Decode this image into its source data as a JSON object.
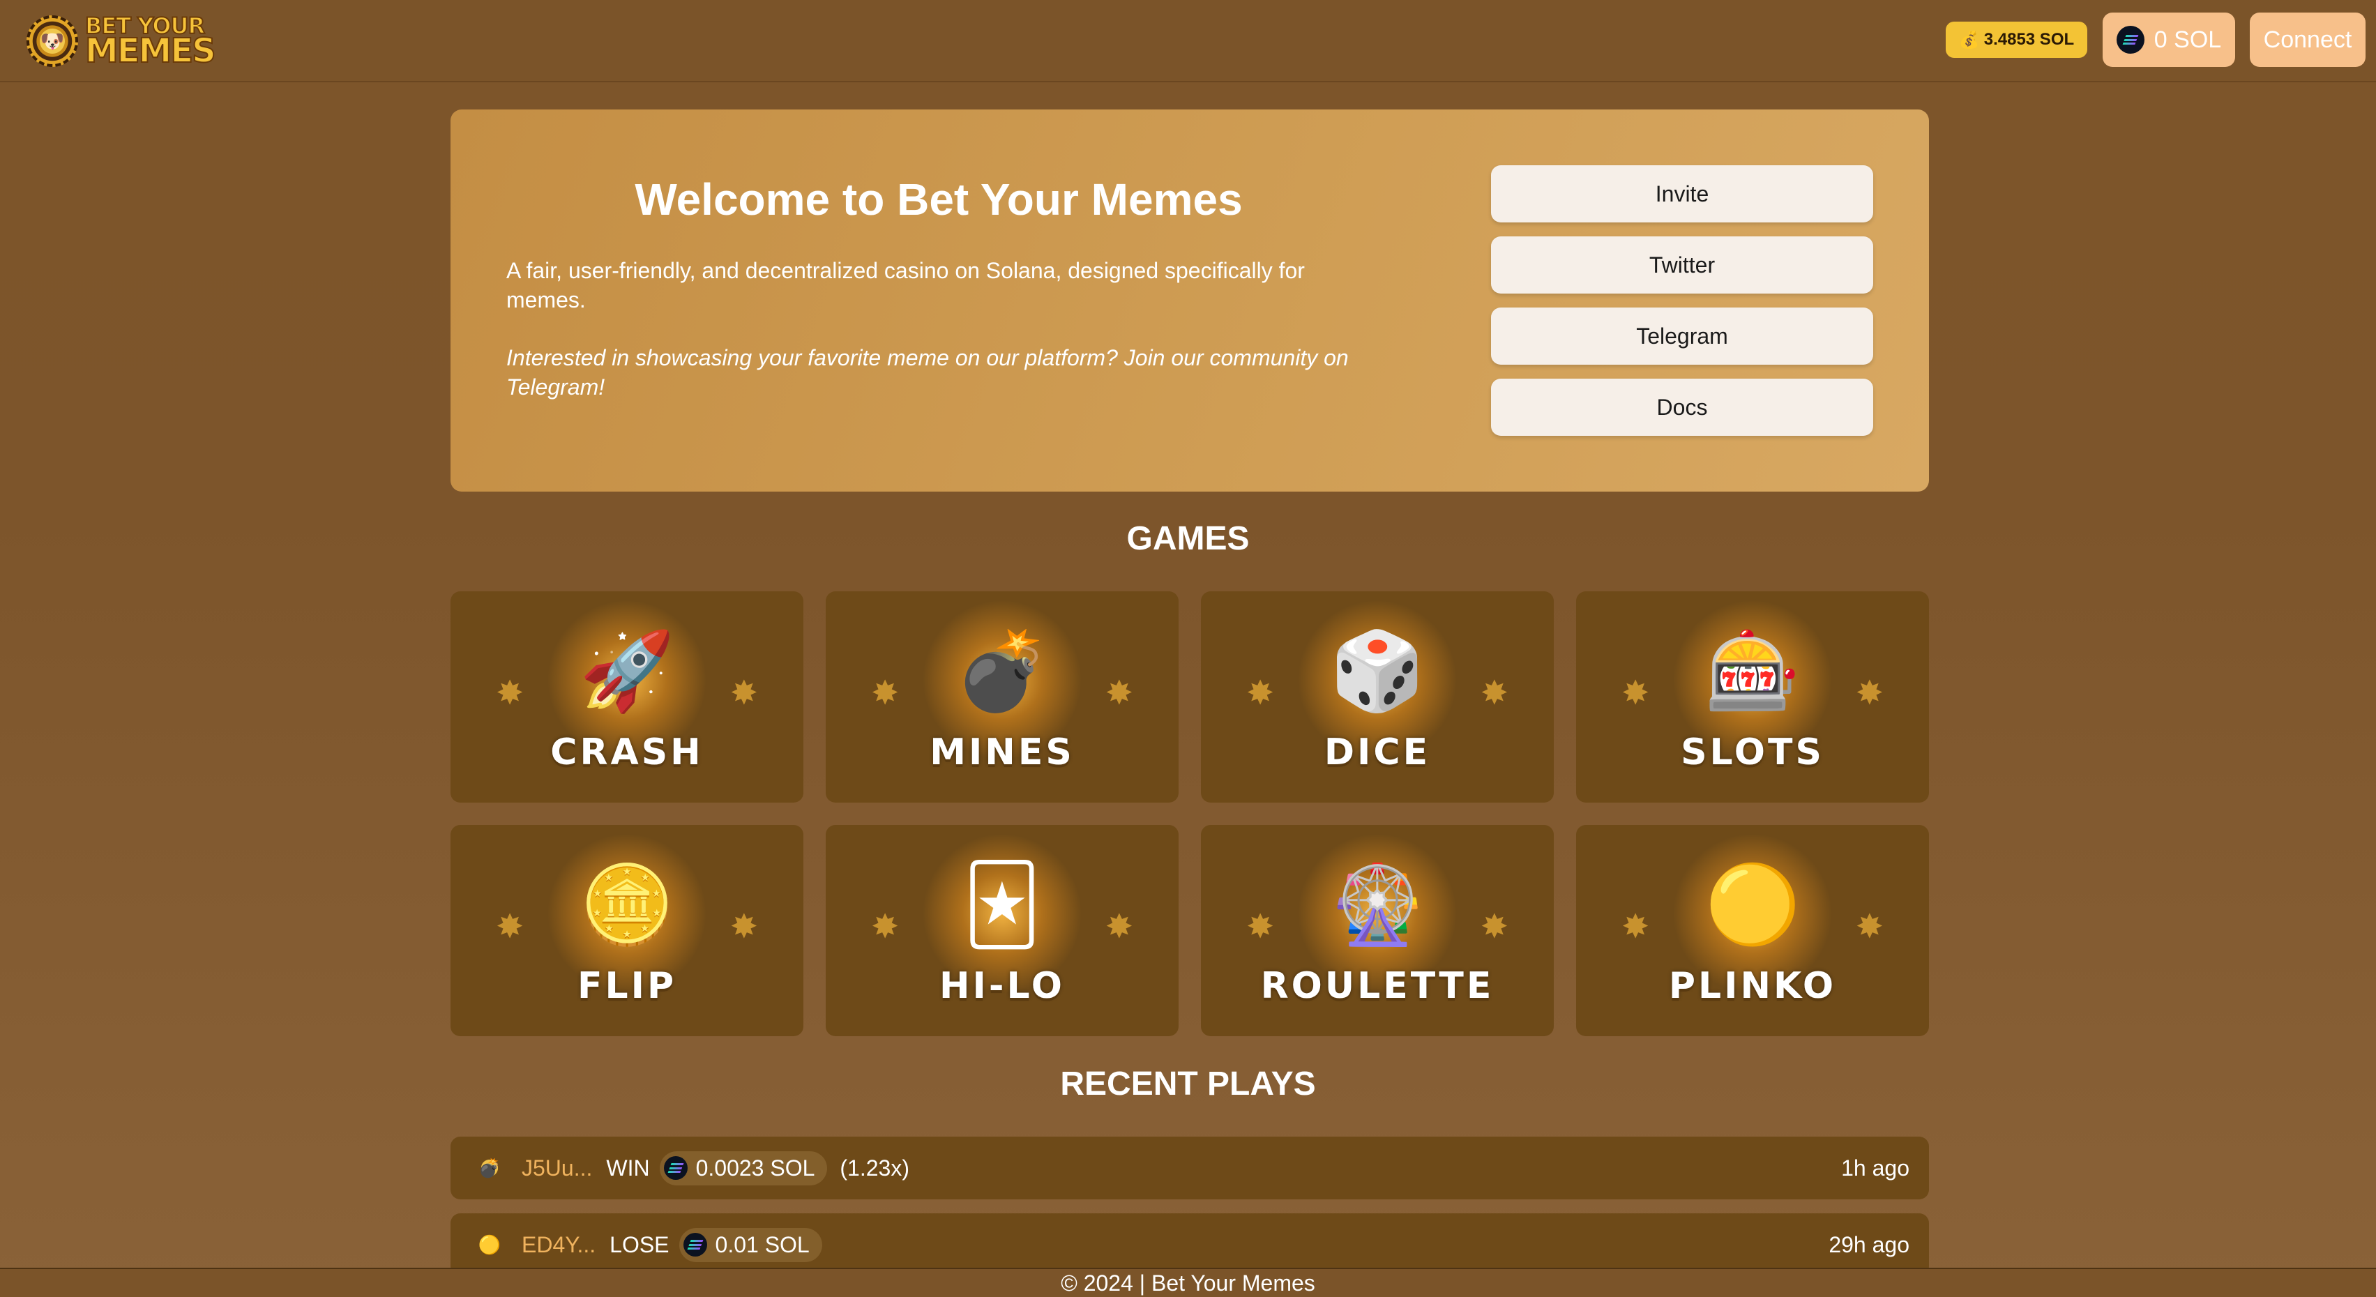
{
  "header": {
    "logo": {
      "line1": "BET YOUR",
      "line2": "MEMES",
      "icon": "casino-chip-logo-icon"
    },
    "balance": "3.4853 SOL",
    "wallet_balance": "0 SOL",
    "connect_label": "Connect"
  },
  "hero": {
    "title": "Welcome to Bet Your Memes",
    "description": "A fair, user-friendly, and decentralized casino on Solana, designed specifically for memes.",
    "cta": "Interested in showcasing your favorite meme on our platform? Join our community on Telegram!",
    "links": [
      "Invite",
      "Twitter",
      "Telegram",
      "Docs"
    ]
  },
  "games_title": "GAMES",
  "games": [
    {
      "name": "CRASH",
      "icon": "rocket-icon"
    },
    {
      "name": "MINES",
      "icon": "bomb-icon"
    },
    {
      "name": "DICE",
      "icon": "dice-icon"
    },
    {
      "name": "SLOTS",
      "icon": "slot-machine-icon"
    },
    {
      "name": "FLIP",
      "icon": "coin-flip-icon"
    },
    {
      "name": "HI-LO",
      "icon": "playing-cards-icon"
    },
    {
      "name": "ROULETTE",
      "icon": "roulette-wheel-icon"
    },
    {
      "name": "PLINKO",
      "icon": "plinko-coin-icon"
    }
  ],
  "recent_title": "RECENT PLAYS",
  "recent_plays": [
    {
      "player": "J5Uu...",
      "outcome": "WIN",
      "amount": "0.0023 SOL",
      "multiplier": "(1.23x)",
      "time": "1h ago",
      "icon": "mines-game-icon"
    },
    {
      "player": "ED4Y...",
      "outcome": "LOSE",
      "amount": "0.01 SOL",
      "multiplier": "",
      "time": "29h ago",
      "icon": "plinko-game-icon"
    }
  ],
  "footer": "© 2024 | Bet Your Memes",
  "colors": {
    "background": "#7d552a",
    "hero": "#c48e44",
    "card": "#6e4a18",
    "accent": "#f3c335",
    "button": "#f7c08a",
    "player": "#f0b35e"
  }
}
